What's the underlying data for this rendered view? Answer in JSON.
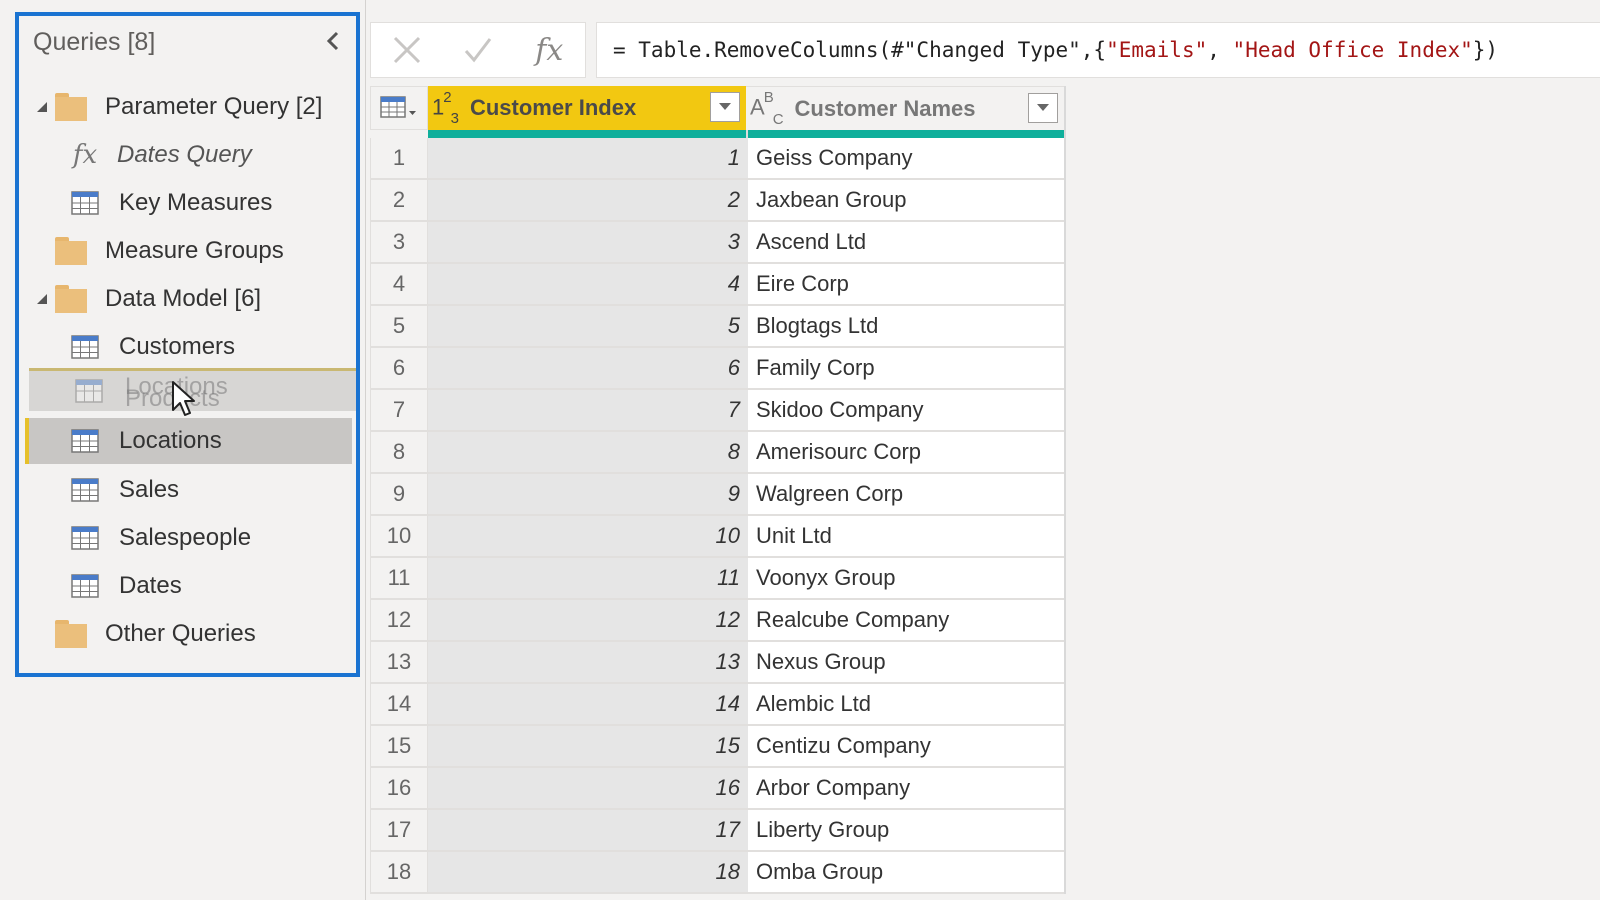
{
  "queries_pane": {
    "title": "Queries [8]",
    "collapse_icon": "chevron-left-icon",
    "items": [
      {
        "type": "folder",
        "label": "Parameter Query [2]",
        "expanded": true,
        "icon": "folder-icon"
      },
      {
        "type": "function",
        "label": "Dates Query",
        "icon": "fx-icon"
      },
      {
        "type": "table",
        "label": "Key Measures",
        "icon": "table-icon"
      },
      {
        "type": "folder",
        "label": "Measure Groups",
        "icon": "folder-icon"
      },
      {
        "type": "folder",
        "label": "Data Model [6]",
        "expanded": true,
        "icon": "folder-icon"
      },
      {
        "type": "table",
        "label": "Customers",
        "icon": "table-icon"
      },
      {
        "type": "table",
        "label": "Locations",
        "icon": "table-icon",
        "selected": true
      },
      {
        "type": "table",
        "label": "Sales",
        "icon": "table-icon"
      },
      {
        "type": "table",
        "label": "Salespeople",
        "icon": "table-icon"
      },
      {
        "type": "table",
        "label": "Dates",
        "icon": "table-icon"
      },
      {
        "type": "folder",
        "label": "Other Queries",
        "icon": "folder-icon"
      }
    ],
    "drag_ghost": {
      "dragged_label": "Locations",
      "underlying_label": "Products"
    }
  },
  "formula_bar": {
    "cancel_icon": "close-icon",
    "commit_icon": "check-icon",
    "fx_label": "fx",
    "formula_prefix": "= Table.RemoveColumns(#\"Changed Type\",{",
    "formula_str1": "\"Emails\"",
    "formula_sep": ", ",
    "formula_str2": "\"Head Office Index\"",
    "formula_suffix": "})"
  },
  "grid": {
    "corner_icon": "table-menu-icon",
    "columns": [
      {
        "name": "Customer Index",
        "type_icon": "whole-number-icon",
        "type_text": "123",
        "selected": true
      },
      {
        "name": "Customer Names",
        "type_icon": "text-type-icon",
        "type_text": "ABC"
      }
    ],
    "rows": [
      {
        "n": "1",
        "index": "1",
        "name": "Geiss Company"
      },
      {
        "n": "2",
        "index": "2",
        "name": "Jaxbean Group"
      },
      {
        "n": "3",
        "index": "3",
        "name": "Ascend Ltd"
      },
      {
        "n": "4",
        "index": "4",
        "name": "Eire Corp"
      },
      {
        "n": "5",
        "index": "5",
        "name": "Blogtags Ltd"
      },
      {
        "n": "6",
        "index": "6",
        "name": "Family Corp"
      },
      {
        "n": "7",
        "index": "7",
        "name": "Skidoo Company"
      },
      {
        "n": "8",
        "index": "8",
        "name": "Amerisourc Corp"
      },
      {
        "n": "9",
        "index": "9",
        "name": "Walgreen Corp"
      },
      {
        "n": "10",
        "index": "10",
        "name": "Unit Ltd"
      },
      {
        "n": "11",
        "index": "11",
        "name": "Voonyx Group"
      },
      {
        "n": "12",
        "index": "12",
        "name": "Realcube Company"
      },
      {
        "n": "13",
        "index": "13",
        "name": "Nexus Group"
      },
      {
        "n": "14",
        "index": "14",
        "name": "Alembic Ltd"
      },
      {
        "n": "15",
        "index": "15",
        "name": "Centizu Company"
      },
      {
        "n": "16",
        "index": "16",
        "name": "Arbor Company"
      },
      {
        "n": "17",
        "index": "17",
        "name": "Liberty Group"
      },
      {
        "n": "18",
        "index": "18",
        "name": "Omba Group"
      }
    ]
  },
  "colors": {
    "focus_border": "#1a73d1",
    "selected_column_header": "#f2c811",
    "column_quality": "#0faf9b",
    "folder": "#ebbf7c",
    "formula_string": "#a31515"
  }
}
